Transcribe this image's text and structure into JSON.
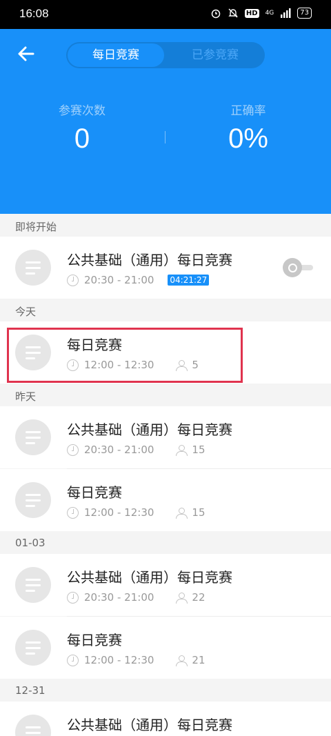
{
  "status_bar": {
    "time": "16:08",
    "network": "4G",
    "battery": "73"
  },
  "header": {
    "tabs": [
      {
        "label": "每日竞赛",
        "active": true
      },
      {
        "label": "已参竞赛",
        "active": false
      }
    ],
    "stats": [
      {
        "label": "参赛次数",
        "value": "0"
      },
      {
        "label": "正确率",
        "value": "0%"
      }
    ]
  },
  "sections": [
    {
      "label": "即将开始"
    },
    {
      "label": "今天"
    },
    {
      "label": "昨天"
    },
    {
      "label": "01-03"
    },
    {
      "label": "12-31"
    }
  ],
  "items": [
    {
      "title": "公共基础（通用）每日竞赛",
      "time": "20:30 - 21:00",
      "countdown": "04:21:27"
    },
    {
      "title": "每日竞赛",
      "time": "12:00 - 12:30",
      "count": "5"
    },
    {
      "title": "公共基础（通用）每日竞赛",
      "time": "20:30 - 21:00",
      "count": "15"
    },
    {
      "title": "每日竞赛",
      "time": "12:00 - 12:30",
      "count": "15"
    },
    {
      "title": "公共基础（通用）每日竞赛",
      "time": "20:30 - 21:00",
      "count": "22"
    },
    {
      "title": "每日竞赛",
      "time": "12:00 - 12:30",
      "count": "21"
    },
    {
      "title": "公共基础（通用）每日竞赛"
    }
  ],
  "colors": {
    "primary": "#1890f9",
    "highlight": "#e0334e"
  },
  "icons": [
    "back-arrow-icon",
    "clock-icon",
    "person-icon",
    "alarm-toggle-icon",
    "list-icon"
  ]
}
